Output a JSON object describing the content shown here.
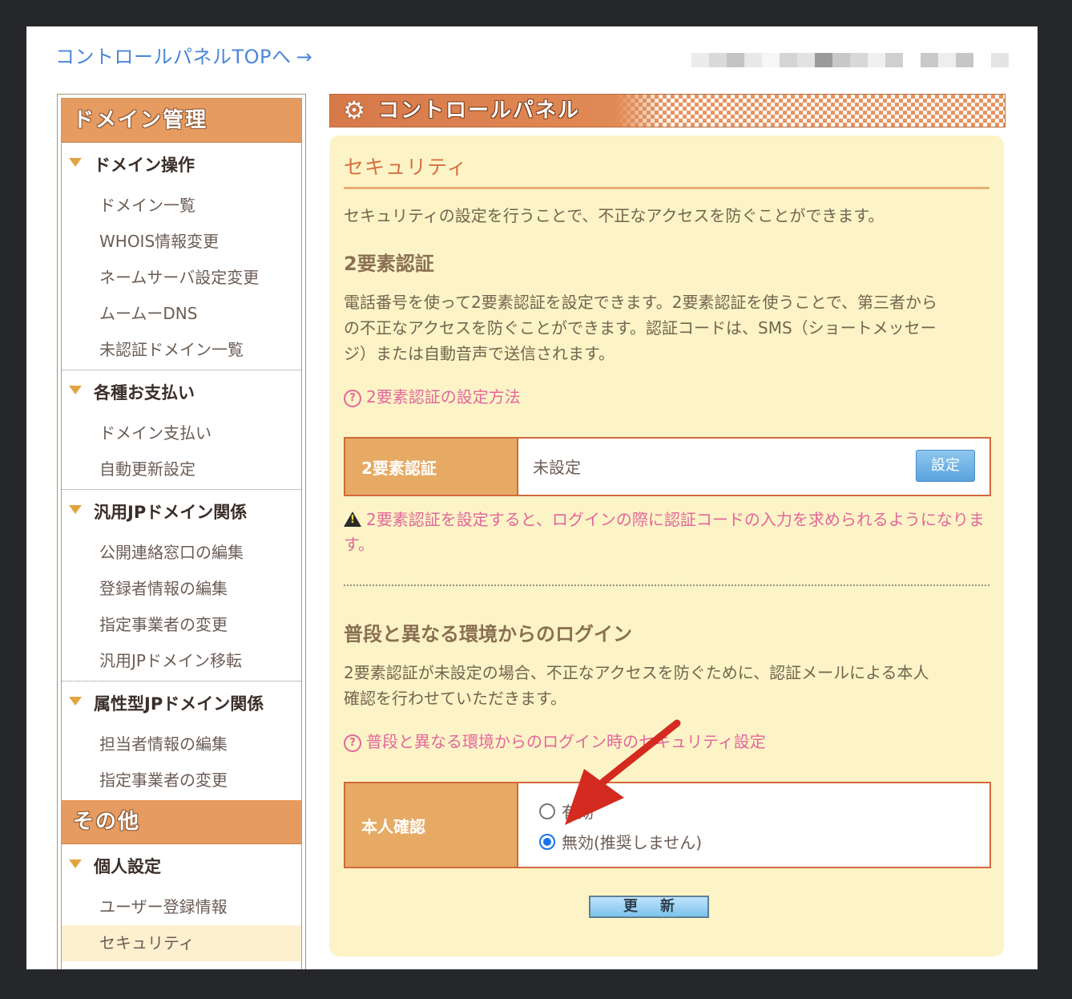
{
  "top_link": {
    "label": "コントロールパネルTOPへ",
    "arrow": "→"
  },
  "sidebar": {
    "sections": [
      {
        "header": "ドメイン管理",
        "groups": [
          {
            "title": "ドメイン操作",
            "items": [
              "ドメイン一覧",
              "WHOIS情報変更",
              "ネームサーバ設定変更",
              "ムームーDNS",
              "未認証ドメイン一覧"
            ]
          },
          {
            "title": "各種お支払い",
            "items": [
              "ドメイン支払い",
              "自動更新設定"
            ]
          },
          {
            "title": "汎用JPドメイン関係",
            "items": [
              "公開連絡窓口の編集",
              "登録者情報の編集",
              "指定事業者の変更",
              "汎用JPドメイン移転"
            ]
          },
          {
            "title": "属性型JPドメイン関係",
            "items": [
              "担当者情報の編集",
              "指定事業者の変更"
            ]
          }
        ]
      },
      {
        "header": "その他",
        "groups": [
          {
            "title": "個人設定",
            "items": [
              "ユーザー登録情報",
              "セキュリティ"
            ],
            "active_item": "セキュリティ"
          }
        ]
      }
    ]
  },
  "banner": {
    "title": "コントロールパネル",
    "icon": "gear-icon"
  },
  "main": {
    "title": "セキュリティ",
    "intro": "セキュリティの設定を行うことで、不正なアクセスを防ぐことができます。",
    "two_factor": {
      "heading": "2要素認証",
      "description_line1": "電話番号を使って2要素認証を設定できます。2要素認証を使うことで、第三者から",
      "description_line2": "の不正なアクセスを防ぐことができます。認証コードは、SMS（ショートメッセー",
      "description_line3": "ジ）または自動音声で送信されます。",
      "help_link": "2要素認証の設定方法",
      "table_label": "2要素認証",
      "table_value": "未設定",
      "button_label": "設定",
      "warning_line1": "2要素認証を設定すると、ログインの際に認証コードの入力を求められるようになりま",
      "warning_line2": "す。"
    },
    "login_env": {
      "heading": "普段と異なる環境からのログイン",
      "description_line1": "2要素認証が未設定の場合、不正なアクセスを防ぐために、認証メールによる本人",
      "description_line2": "確認を行わせていただきます。",
      "help_link": "普段と異なる環境からのログイン時のセキュリティ設定",
      "table_label": "本人確認",
      "option_enabled": "有効",
      "option_disabled": "無効(推奨しません)",
      "selected": "無効(推奨しません)"
    },
    "update_button": "更新"
  },
  "colors": {
    "accent_orange": "#e69b60",
    "link_blue": "#4a86d8",
    "pink_text": "#e2679c",
    "panel_bg": "#fcf4c6",
    "annotation_red": "#d42a20"
  }
}
